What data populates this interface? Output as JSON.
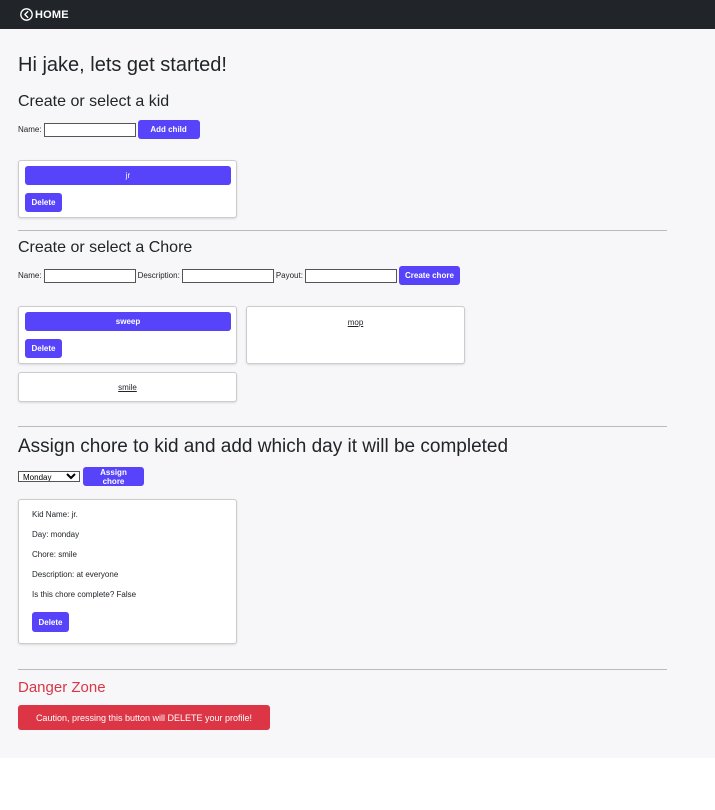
{
  "nav": {
    "home_label": "HOME"
  },
  "greeting": "Hi jake, lets get started!",
  "kids": {
    "heading": "Create or select a kid",
    "name_label": "Name:",
    "name_value": "",
    "add_label": "Add child",
    "cards": [
      {
        "name": "jr",
        "delete_label": "Delete"
      }
    ]
  },
  "chores": {
    "heading": "Create or select a Chore",
    "name_label": "Name:",
    "description_label": "Description:",
    "payout_label": "Payout:",
    "create_label": "Create chore",
    "cards": [
      {
        "name": "sweep",
        "delete_label": "Delete"
      },
      {
        "name": "mop"
      },
      {
        "name": "smile"
      }
    ]
  },
  "assign": {
    "heading": "Assign chore to kid and add which day it will be completed",
    "day_selected": "Monday",
    "assign_label": "Assign chore",
    "card": {
      "kid_name": "Kid Name: jr.",
      "day": "Day: monday",
      "chore": "Chore: smile",
      "description": "Description: at everyone",
      "complete": "Is this chore complete? False",
      "delete_label": "Delete"
    }
  },
  "danger": {
    "heading": "Danger Zone",
    "button_label": "Caution, pressing this button will DELETE your profile!"
  },
  "colors": {
    "accent": "#5643fa",
    "danger": "#dc3545",
    "navbar": "#212529"
  }
}
